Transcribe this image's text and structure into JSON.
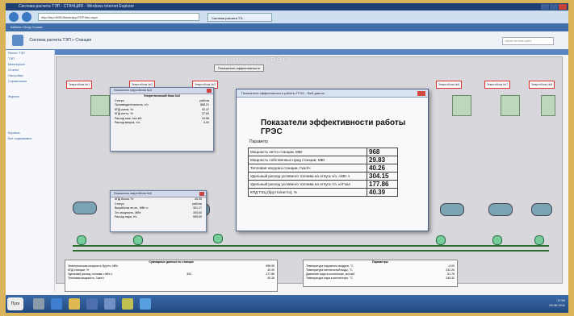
{
  "browser": {
    "title": "Система расчета ТЭП - СТАНЦИЯ - Windows Internet Explorer",
    "url": "http://tepl:5050/ModeApp/TEPInfo.aspx",
    "tab": "Система расчета ТЭ..."
  },
  "app": {
    "menu": "Кабинет  Вход  Сервис",
    "breadcrumb": "Система расчета ТЭП » Станция",
    "search_placeholder": "Найти на этом сайте"
  },
  "sidebar": {
    "items": [
      "Расчет ТЭП",
      "ТЭП",
      "Мониторинг",
      "Отчеты",
      "Настройки",
      "Справочники",
      "Журнал",
      "Корзина",
      "Все содержимое"
    ]
  },
  "mimic": {
    "title": "Костромская ГРЭС",
    "efficiency_button": "Показатели эффективности",
    "units": [
      "Энергоблок №1",
      "Энергоблок №2",
      "Энергоблок №3",
      "Энергоблок №6",
      "Энергоблок №7",
      "Энергоблок №8"
    ]
  },
  "unit_popup": {
    "header": "Показатели энергоблока №3",
    "title": "Энергетический блок №3",
    "rows": [
      [
        "Статус:",
        "работа"
      ],
      [
        "Производительность, т/ч:",
        "888.21"
      ],
      [
        "КПД котла, %:",
        "92.47"
      ],
      [
        "КПД нетто, %:",
        "37.83"
      ],
      [
        "Расход газа, тыс.м3:",
        "34.58"
      ],
      [
        "Расход мазута, т/ч:",
        "0.00"
      ]
    ]
  },
  "gen_popup": {
    "header": "Показатели энергоблока №8",
    "rows": [
      [
        "КПД блока, %:",
        "40.35"
      ],
      [
        "Статус:",
        "работа"
      ],
      [
        "Выработка эл.эн., МВт·ч:",
        "301.17"
      ],
      [
        "Эл. мощность, МВт:",
        "300.00"
      ],
      [
        "Расход пара, т/ч:",
        "905.00"
      ]
    ]
  },
  "efficiency_popup": {
    "header": "Показатели эффективности работы ГРЭС - Веб-диалог",
    "title": "Показатели эффективности работы ГРЭС",
    "param_label": "Параметр",
    "rows": [
      [
        "Мощность нетто станции, МВт",
        "968"
      ],
      [
        "Мощность собственных нужд станции, МВт",
        "29.83"
      ],
      [
        "Тепловая нагрузка станции, Гкал/ч",
        "40.26"
      ],
      [
        "Удельный расход условного топлива на отпуск э/э, г/кВт·ч",
        "304.15"
      ],
      [
        "Удельный расход условного топлива на отпуск т/э, кг/Гкал",
        "177.86"
      ],
      [
        "КПД ТЭЦ (брутто/нетто), %",
        "40.39"
      ]
    ]
  },
  "bottom_left": {
    "header": "Суммарные данные по станции",
    "rows": [
      [
        "Электрическая мощность брутто, МВт",
        "998.05",
        ""
      ],
      [
        "КПД станции, %",
        "40.39",
        ""
      ],
      [
        "Удельный расход топлива, г/кВт·ч",
        "304",
        "177.86"
      ],
      [
        "Тепловая мощность, Гкал/ч",
        "40.26",
        ""
      ]
    ]
  },
  "bottom_right": {
    "header": "Параметры",
    "rows": [
      [
        "Температура наружного воздуха, °C",
        "-4.00"
      ],
      [
        "Температура питательной воды, °C",
        "232.26"
      ],
      [
        "Давление пара в коллекторе, кгс/см2",
        "51.76"
      ],
      [
        "Температура пара в коллекторе, °C",
        "245.32"
      ]
    ]
  },
  "taskbar": {
    "start": "Пуск",
    "time": "17:50",
    "date": "09.06.2011"
  },
  "colors": {
    "accent": "#3f6ea8",
    "frame": "#d9b45a",
    "unit_border": "#dd3333"
  }
}
